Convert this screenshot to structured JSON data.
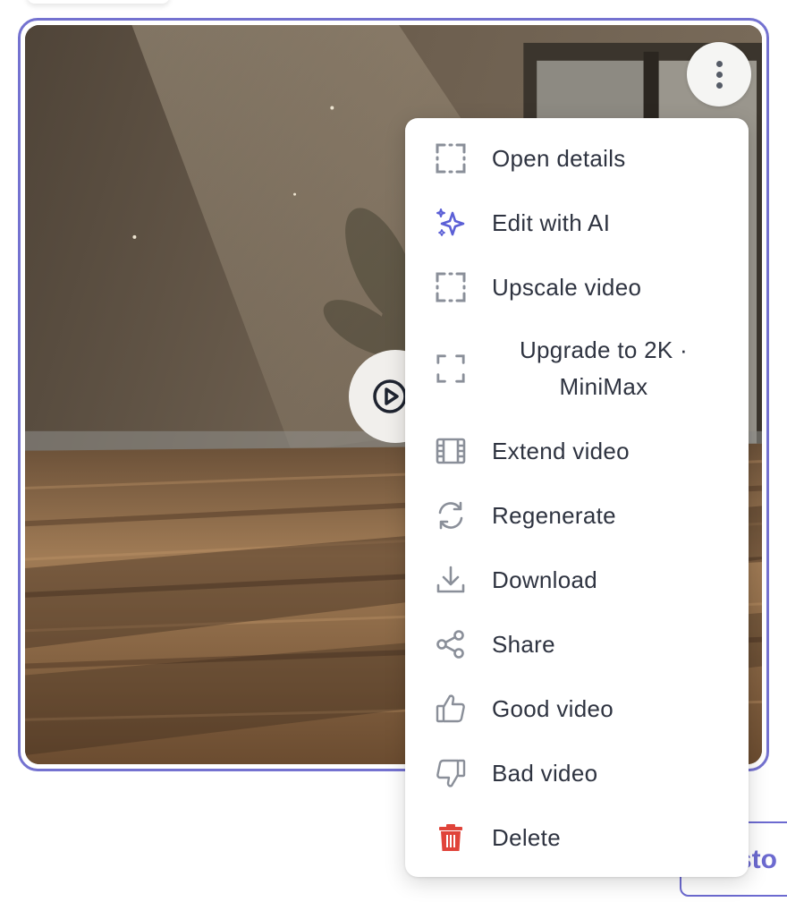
{
  "menu": {
    "items": [
      {
        "label": "Open details",
        "icon": "expand-icon"
      },
      {
        "label": "Edit with AI",
        "icon": "sparkles-icon"
      },
      {
        "label": "Upscale video",
        "icon": "expand-icon"
      },
      {
        "label": "Upgrade to 2K · MiniMax",
        "icon": "expand-icon"
      },
      {
        "label": "Extend video",
        "icon": "film-icon"
      },
      {
        "label": "Regenerate",
        "icon": "refresh-icon"
      },
      {
        "label": "Download",
        "icon": "download-icon"
      },
      {
        "label": "Share",
        "icon": "share-icon"
      },
      {
        "label": "Good video",
        "icon": "thumbs-up-icon"
      },
      {
        "label": "Bad video",
        "icon": "thumbs-down-icon"
      },
      {
        "label": "Delete",
        "icon": "trash-icon"
      }
    ]
  },
  "background_button": {
    "label": "sto"
  },
  "colors": {
    "accent": "#7472d0",
    "delete": "#e0443a",
    "text": "#2e3340",
    "icon": "#8a8f99",
    "ai_icon": "#5b5fd6"
  }
}
